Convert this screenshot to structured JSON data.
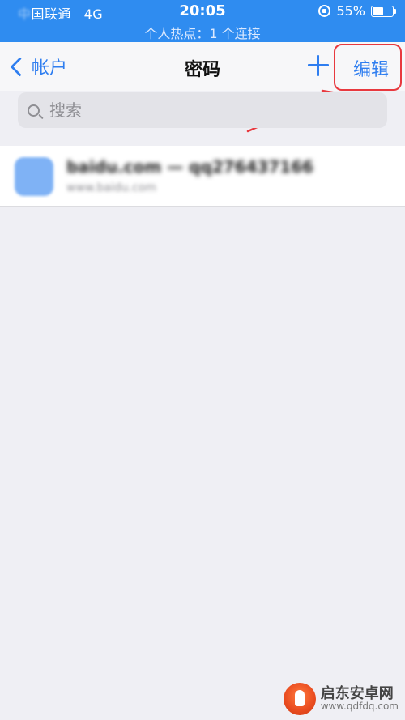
{
  "status_bar": {
    "carrier_blurred": "中",
    "carrier": "国联通",
    "network": "4G",
    "time": "20:05",
    "battery_percent": "55%",
    "battery_level": 0.55,
    "hotspot": "个人热点：1 个连接"
  },
  "navbar": {
    "back_label": "帐户",
    "title": "密码",
    "add_icon": "plus-icon",
    "edit_label": "编辑"
  },
  "search": {
    "placeholder": "搜索"
  },
  "list": {
    "items": [
      {
        "title": "baidu.com — qq276437166",
        "subtitle": "www.baidu.com",
        "icon": "key-icon"
      }
    ]
  },
  "annotation": {
    "color": "#e8393f"
  },
  "watermark": {
    "name": "启东安卓网",
    "url": "www.qdfdq.com"
  },
  "colors": {
    "status_bar_bg": "#2f8cf0",
    "accent": "#2f7ef0",
    "background": "#efeff4"
  }
}
